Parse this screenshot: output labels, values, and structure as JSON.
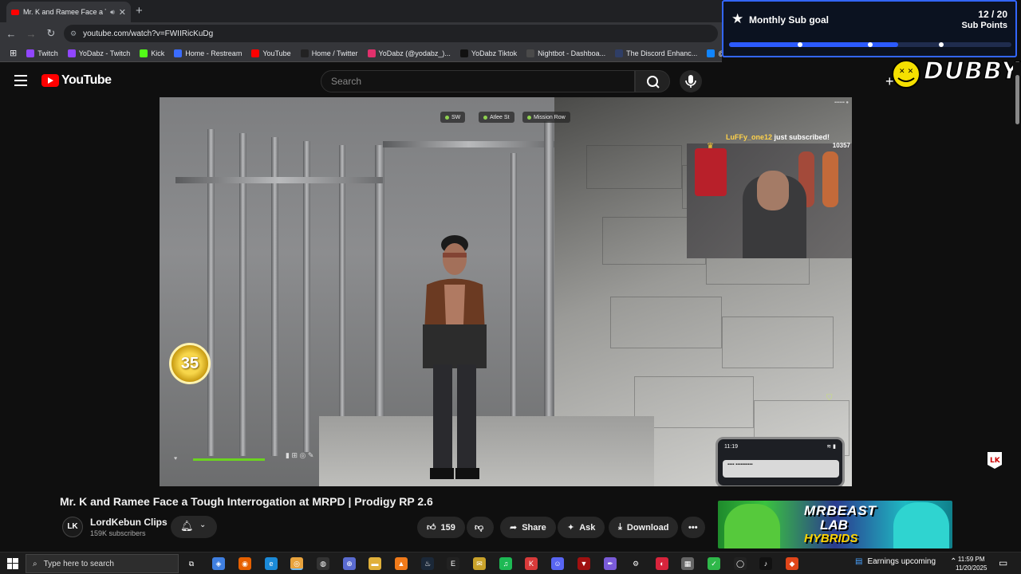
{
  "browser": {
    "tab_title": "Mr. K and Ramee Face a To",
    "url": "youtube.com/watch?v=FWIIRicKuDg",
    "bookmarks": [
      {
        "label": "Twitch",
        "color": "#9146ff"
      },
      {
        "label": "YoDabz - Twitch",
        "color": "#9146ff"
      },
      {
        "label": "Kick",
        "color": "#53fc18"
      },
      {
        "label": "Home - Restream",
        "color": "#3b6cff"
      },
      {
        "label": "YouTube",
        "color": "#ff0000"
      },
      {
        "label": "Home / Twitter",
        "color": "#222222"
      },
      {
        "label": "YoDabz (@yodabz_)...",
        "color": "#e1306c"
      },
      {
        "label": "YoDabz Tiktok",
        "color": "#111111"
      },
      {
        "label": "Nightbot - Dashboa...",
        "color": "#4a4a4a"
      },
      {
        "label": "The Discord Enhanc...",
        "color": "#2f3e66"
      },
      {
        "label": "@yodabz.bsky.socia...",
        "color": "#1185fe"
      }
    ]
  },
  "subgoal": {
    "title": "Monthly Sub goal",
    "count": "12 / 20",
    "unit": "Sub Points",
    "progress": 0.6,
    "ticks": [
      0.25,
      0.5,
      0.75
    ]
  },
  "youtube": {
    "logo_text": "YouTube",
    "search_placeholder": "Search",
    "dubby_text": "DUBBY"
  },
  "stream": {
    "hud_chips": [
      "SW",
      "Atlee St",
      "Mission Row"
    ],
    "level_badge": "35",
    "sub_alert_name": "LuFFy_one12",
    "sub_alert_text": " just subscribed!",
    "sub_alert_number": "10357",
    "phone_time": "11:19"
  },
  "video": {
    "title": "Mr. K and Ramee Face a Tough Interrogation at MRPD | Prodigy RP 2.6",
    "channel": "LordKebun Clips",
    "subscribers": "159K subscribers",
    "avatar_text": "LK",
    "likes": "159",
    "share": "Share",
    "ask": "Ask",
    "download": "Download"
  },
  "ad": {
    "line1": "MRBEAST",
    "line2": "LAB",
    "line3": "HYBRIDS"
  },
  "taskbar": {
    "search_placeholder": "Type here to search",
    "tray_label": "Earnings upcoming",
    "time": "11:59 PM",
    "date": "11/20/2025"
  }
}
